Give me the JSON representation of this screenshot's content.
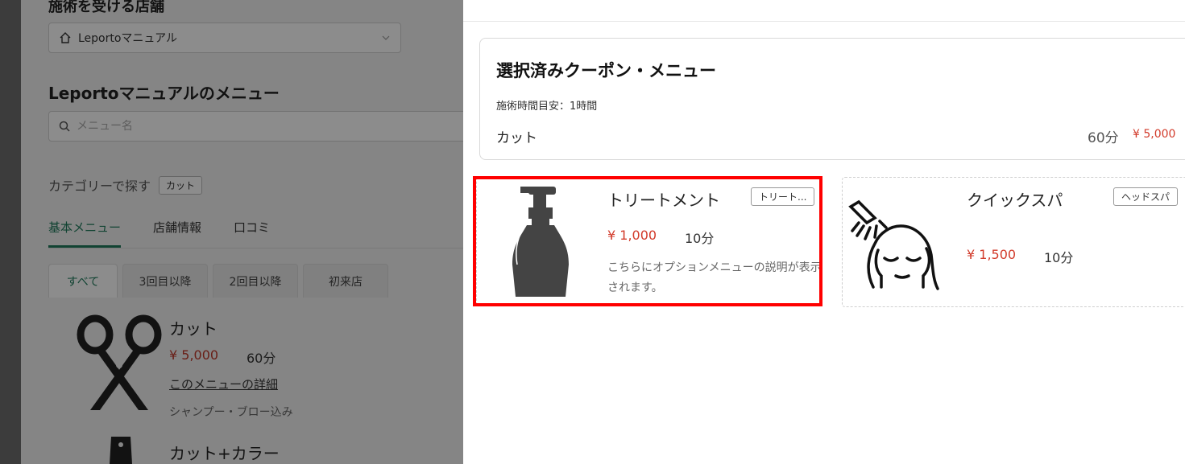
{
  "background": {
    "store_heading": "施術を受ける店舗",
    "store_select_value": "Leportoマニュアル",
    "menu_heading": "Leportoマニュアルのメニュー",
    "search_placeholder": "メニュー名",
    "category_label": "カテゴリーで探す",
    "category_chip": "カット",
    "tabs": [
      "基本メニュー",
      "店舗情報",
      "口コミ"
    ],
    "subtabs": [
      "すべて",
      "3回目以降",
      "2回目以降",
      "初来店"
    ],
    "items": [
      {
        "name": "カット",
        "price": "¥ 5,000",
        "duration": "60分",
        "link": "このメニューの詳細",
        "note": "シャンプー・ブロー込み"
      },
      {
        "name": "カット+カラー"
      }
    ]
  },
  "selected": {
    "title": "選択済みクーポン・メニュー",
    "time_estimate": "施術時間目安：1時間",
    "item_name": "カット",
    "item_duration": "60分",
    "item_price": "¥ 5,000"
  },
  "options": [
    {
      "name": "トリートメント",
      "tag": "トリート...",
      "price": "¥ 1,000",
      "duration": "10分",
      "description": "こちらにオプションメニューの説明が表示されます。",
      "icon": "pump-bottle-icon"
    },
    {
      "name": "クイックスパ",
      "tag": "ヘッドスパ",
      "price": "¥ 1,500",
      "duration": "10分",
      "icon": "head-spa-icon"
    }
  ],
  "colors": {
    "accent": "#1f7a5c",
    "price": "#d23b2b",
    "highlight": "#ff0000"
  }
}
